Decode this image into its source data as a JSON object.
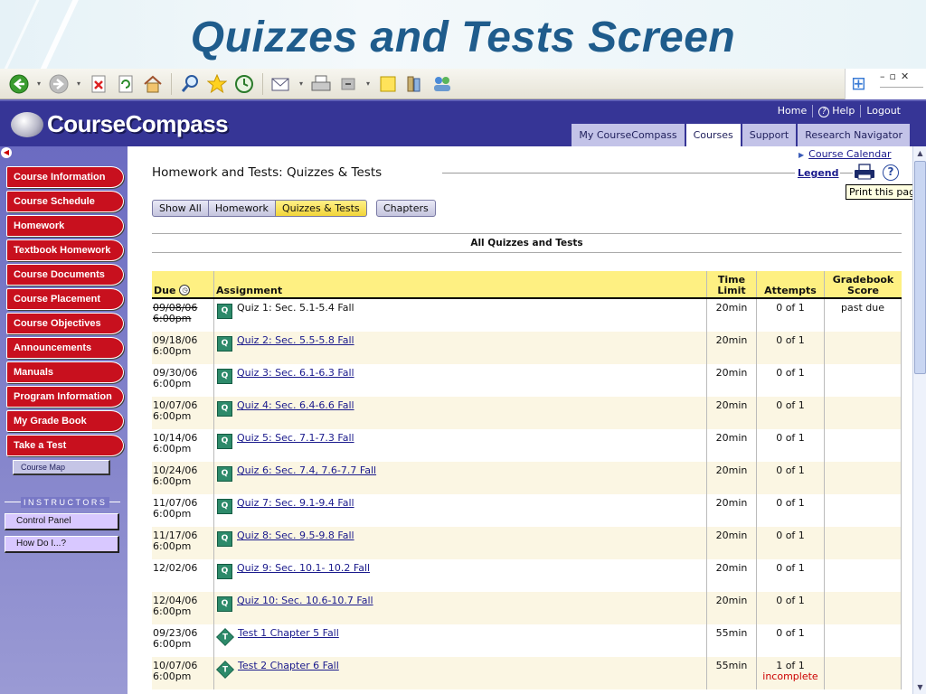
{
  "slide": {
    "title": "Quizzes and Tests Screen"
  },
  "tooltip": "Print this page",
  "header": {
    "logo_text": "CourseCompass",
    "top_links": [
      "Home",
      "Help",
      "Logout"
    ],
    "tabs": [
      {
        "label": "My CourseCompass",
        "active": false
      },
      {
        "label": "Courses",
        "active": true
      },
      {
        "label": "Support",
        "active": false
      },
      {
        "label": "Research Navigator",
        "active": false
      }
    ]
  },
  "sidebar": {
    "items": [
      "Course Information",
      "Course Schedule",
      "Homework",
      "Textbook Homework",
      "Course Documents",
      "Course Placement",
      "Course Objectives",
      "Announcements",
      "Manuals",
      "Program Information",
      "My Grade Book",
      "Take a Test"
    ],
    "course_map": "Course Map",
    "instructors_label": "INSTRUCTORS",
    "instructor_items": [
      "Control Panel",
      "How Do I...?"
    ]
  },
  "main": {
    "calendar_link": "Course Calendar",
    "heading": "Homework and Tests: Quizzes & Tests",
    "legend_link": "Legend",
    "filters": [
      "Show All",
      "Homework",
      "Quizzes & Tests"
    ],
    "active_filter": 2,
    "chapters_button": "Chapters",
    "section_title": "All Quizzes and Tests",
    "columns": {
      "due": "Due",
      "assignment": "Assignment",
      "time_limit_1": "Time",
      "time_limit_2": "Limit",
      "attempts": "Attempts",
      "gradebook_1": "Gradebook",
      "gradebook_2": "Score"
    },
    "rows": [
      {
        "due_date": "09/08/06",
        "due_time": "6:00pm",
        "type": "Q",
        "title": "Quiz 1: Sec. 5.1-5.4 Fall",
        "time": "20min",
        "attempts": "0 of 1",
        "score": "past due",
        "status": ""
      },
      {
        "due_date": "09/18/06",
        "due_time": "6:00pm",
        "type": "Q",
        "title": "Quiz 2: Sec. 5.5-5.8 Fall",
        "time": "20min",
        "attempts": "0 of 1",
        "score": "",
        "status": ""
      },
      {
        "due_date": "09/30/06",
        "due_time": "6:00pm",
        "type": "Q",
        "title": "Quiz 3: Sec. 6.1-6.3 Fall",
        "time": "20min",
        "attempts": "0 of 1",
        "score": "",
        "status": ""
      },
      {
        "due_date": "10/07/06",
        "due_time": "6:00pm",
        "type": "Q",
        "title": "Quiz 4: Sec. 6.4-6.6 Fall",
        "time": "20min",
        "attempts": "0 of 1",
        "score": "",
        "status": ""
      },
      {
        "due_date": "10/14/06",
        "due_time": "6:00pm",
        "type": "Q",
        "title": "Quiz 5: Sec. 7.1-7.3 Fall",
        "time": "20min",
        "attempts": "0 of 1",
        "score": "",
        "status": ""
      },
      {
        "due_date": "10/24/06",
        "due_time": "6:00pm",
        "type": "Q",
        "title": "Quiz 6: Sec. 7.4, 7.6-7.7 Fall",
        "time": "20min",
        "attempts": "0 of 1",
        "score": "",
        "status": ""
      },
      {
        "due_date": "11/07/06",
        "due_time": "6:00pm",
        "type": "Q",
        "title": "Quiz 7: Sec. 9.1-9.4 Fall",
        "time": "20min",
        "attempts": "0 of 1",
        "score": "",
        "status": ""
      },
      {
        "due_date": "11/17/06",
        "due_time": "6:00pm",
        "type": "Q",
        "title": "Quiz 8: Sec. 9.5-9.8 Fall",
        "time": "20min",
        "attempts": "0 of 1",
        "score": "",
        "status": ""
      },
      {
        "due_date": "12/02/06",
        "due_time": "",
        "type": "Q",
        "title": "Quiz 9: Sec. 10.1- 10.2 Fall",
        "time": "20min",
        "attempts": "0 of 1",
        "score": "",
        "status": ""
      },
      {
        "due_date": "12/04/06",
        "due_time": "6:00pm",
        "type": "Q",
        "title": "Quiz 10: Sec. 10.6-10.7 Fall",
        "time": "20min",
        "attempts": "0 of 1",
        "score": "",
        "status": ""
      },
      {
        "due_date": "09/23/06",
        "due_time": "6:00pm",
        "type": "T",
        "title": "Test 1 Chapter 5 Fall",
        "time": "55min",
        "attempts": "0 of 1",
        "score": "",
        "status": ""
      },
      {
        "due_date": "10/07/06",
        "due_time": "6:00pm",
        "type": "T",
        "title": "Test 2 Chapter 6 Fall",
        "time": "55min",
        "attempts": "1 of 1",
        "score": "",
        "status": "incomplete"
      }
    ]
  }
}
